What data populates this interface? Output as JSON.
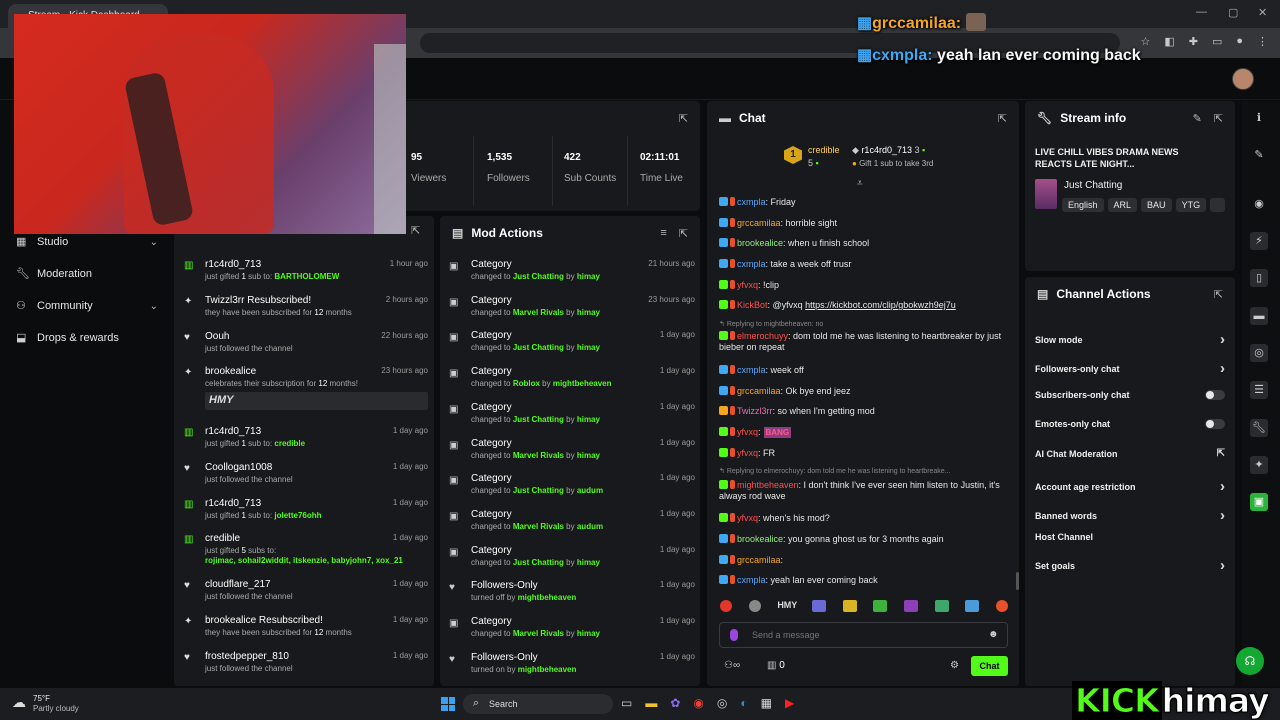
{
  "browser": {
    "tab_title": "Stream - Kick Dashboard"
  },
  "overlay": {
    "chat1_user": "grccamilaa:",
    "chat2_user": "cxmpla:",
    "chat2_text": "yeah lan ever coming back",
    "brand_kick": "KICK",
    "brand_name": "himay"
  },
  "sidebar": {
    "items": [
      {
        "label": "Studio",
        "icon": "studio-icon",
        "chevron": true
      },
      {
        "label": "Moderation",
        "icon": "wrench-icon",
        "chevron": false
      },
      {
        "label": "Community",
        "icon": "community-icon",
        "chevron": true
      },
      {
        "label": "Drops & rewards",
        "icon": "drops-icon",
        "chevron": false
      }
    ]
  },
  "stats": [
    {
      "value": "95",
      "label": "Viewers"
    },
    {
      "value": "1,535",
      "label": "Followers"
    },
    {
      "value": "422",
      "label": "Sub Counts"
    },
    {
      "value": "02:11:01",
      "label": "Time Live"
    }
  ],
  "activity": [
    {
      "icon": "gift-icon",
      "name": "r1c4rd0_713",
      "time": "1 hour ago",
      "pre": "just gifted ",
      "num": "1",
      "mid": " sub to: ",
      "target": "BARTHOLOMEW"
    },
    {
      "icon": "sparkle-icon",
      "name": "Twizzl3rr Resubscribed!",
      "time": "2 hours ago",
      "pre": "they have been subscribed for ",
      "num": "12",
      "mid": " months",
      "target": ""
    },
    {
      "icon": "heart-icon",
      "name": "Oouh",
      "time": "22 hours ago",
      "pre": "just followed the channel",
      "num": "",
      "mid": "",
      "target": ""
    },
    {
      "icon": "sparkle-icon",
      "name": "brookealice",
      "time": "23 hours ago",
      "pre": "celebrates their subscription for ",
      "num": "12",
      "mid": " months!",
      "target": "",
      "emote": "HMY"
    },
    {
      "icon": "gift-icon",
      "name": "r1c4rd0_713",
      "time": "1 day ago",
      "pre": "just gifted ",
      "num": "1",
      "mid": " sub to: ",
      "target": "credible"
    },
    {
      "icon": "heart-icon",
      "name": "Coollogan1008",
      "time": "1 day ago",
      "pre": "just followed the channel",
      "num": "",
      "mid": "",
      "target": ""
    },
    {
      "icon": "gift-icon",
      "name": "r1c4rd0_713",
      "time": "1 day ago",
      "pre": "just gifted ",
      "num": "1",
      "mid": " sub to: ",
      "target": "jolette76ohh"
    },
    {
      "icon": "gift-icon",
      "name": "credible",
      "time": "1 day ago",
      "pre": "just gifted ",
      "num": "5",
      "mid": " subs to:",
      "target": "rojimac, sohail2widdit, itskenzie, babyjohn7, xox_21"
    },
    {
      "icon": "heart-icon",
      "name": "cloudflare_217",
      "time": "1 day ago",
      "pre": "just followed the channel",
      "num": "",
      "mid": "",
      "target": ""
    },
    {
      "icon": "sparkle-icon",
      "name": "brookealice Resubscribed!",
      "time": "1 day ago",
      "pre": "they have been subscribed for ",
      "num": "12",
      "mid": " months",
      "target": ""
    },
    {
      "icon": "heart-icon",
      "name": "frostedpepper_810",
      "time": "1 day ago",
      "pre": "just followed the channel",
      "num": "",
      "mid": "",
      "target": ""
    }
  ],
  "mod_actions": {
    "title": "Mod Actions",
    "items": [
      {
        "icon": "category-icon",
        "name": "Category",
        "time": "21 hours ago",
        "pre": "changed to ",
        "what": "Just Chatting",
        "by": "himay"
      },
      {
        "icon": "category-icon",
        "name": "Category",
        "time": "23 hours ago",
        "pre": "changed to ",
        "what": "Marvel Rivals",
        "by": "himay"
      },
      {
        "icon": "category-icon",
        "name": "Category",
        "time": "1 day ago",
        "pre": "changed to ",
        "what": "Just Chatting",
        "by": "himay"
      },
      {
        "icon": "category-icon",
        "name": "Category",
        "time": "1 day ago",
        "pre": "changed to ",
        "what": "Roblox",
        "by": "mightbeheaven"
      },
      {
        "icon": "category-icon",
        "name": "Category",
        "time": "1 day ago",
        "pre": "changed to ",
        "what": "Just Chatting",
        "by": "himay"
      },
      {
        "icon": "category-icon",
        "name": "Category",
        "time": "1 day ago",
        "pre": "changed to ",
        "what": "Marvel Rivals",
        "by": "himay"
      },
      {
        "icon": "category-icon",
        "name": "Category",
        "time": "1 day ago",
        "pre": "changed to ",
        "what": "Just Chatting",
        "by": "audum"
      },
      {
        "icon": "category-icon",
        "name": "Category",
        "time": "1 day ago",
        "pre": "changed to ",
        "what": "Marvel Rivals",
        "by": "audum"
      },
      {
        "icon": "category-icon",
        "name": "Category",
        "time": "1 day ago",
        "pre": "changed to ",
        "what": "Just Chatting",
        "by": "himay"
      },
      {
        "icon": "heart-icon",
        "name": "Followers-Only",
        "time": "1 day ago",
        "pre": "turned off by ",
        "what": "",
        "by": "mightbeheaven"
      },
      {
        "icon": "category-icon",
        "name": "Category",
        "time": "1 day ago",
        "pre": "changed to ",
        "what": "Marvel Rivals",
        "by": "himay"
      },
      {
        "icon": "heart-icon",
        "name": "Followers-Only",
        "time": "1 day ago",
        "pre": "turned on by ",
        "what": "",
        "by": "mightbeheaven"
      }
    ]
  },
  "chat": {
    "title": "Chat",
    "top_gifter": "credible",
    "top_gifter_count": "5",
    "second_gifter": "r1c4rd0_713",
    "second_count": "3",
    "gift_prompt": "Gift 1 sub to take 3rd",
    "messages": [
      {
        "user": "cxmpla",
        "color": "u-blue",
        "text": ": Friday"
      },
      {
        "user": "grccamilaa",
        "color": "u-orange",
        "text": ": horrible sight"
      },
      {
        "user": "brookealice",
        "color": "u-green",
        "text": ": when u finish school"
      },
      {
        "user": "cxmpla",
        "color": "u-blue",
        "text": ": take a week off trusr"
      },
      {
        "user": "yfvxq",
        "color": "u-red",
        "text": ": !clip"
      },
      {
        "user": "KickBot",
        "color": "u-red",
        "text": ": @yfvxq ",
        "link": "https://kickbot.com/clip/gbokwzh9ej7u"
      },
      {
        "reply": "Replying to mightbeheaven: no"
      },
      {
        "user": "elmerochuyy",
        "color": "u-red",
        "text": ": dom told me he was listening to heartbreaker by just bieber on repeat"
      },
      {
        "user": "cxmpla",
        "color": "u-blue",
        "text": ": week off"
      },
      {
        "user": "grccamilaa",
        "color": "u-orange",
        "text": ": Ok bye end jeez"
      },
      {
        "user": "Twizzl3rr",
        "color": "u-pink",
        "text": ": so when I'm getting mod"
      },
      {
        "user": "yfvxq",
        "color": "u-red",
        "text": ":",
        "emote": "BANG"
      },
      {
        "user": "yfvxq",
        "color": "u-red",
        "text": ": FR"
      },
      {
        "reply": "Replying to elmerochuyy: dom told me he was listening to heartbreake..."
      },
      {
        "user": "mightbeheaven",
        "color": "u-red",
        "text": ": I don't think I've ever seen him listen to Justin, it's always rod wave"
      },
      {
        "user": "yfvxq",
        "color": "u-red",
        "text": ": when's his mod?"
      },
      {
        "user": "brookealice",
        "color": "u-green",
        "text": ": you gonna ghost us for 3 months again"
      },
      {
        "user": "grccamilaa",
        "color": "u-orange",
        "text": ":"
      },
      {
        "user": "cxmpla",
        "color": "u-blue",
        "text": ": yeah lan ever coming back"
      }
    ],
    "placeholder": "Send a message",
    "viewer_count": "0",
    "send_label": "Chat"
  },
  "stream_info": {
    "title": "Stream info",
    "stream_title": "LIVE CHILL VIBES DRAMA NEWS REACTS LATE NIGHT...",
    "category": "Just Chatting",
    "tags": [
      "English",
      "ARL",
      "BAU",
      "YTG"
    ]
  },
  "channel_actions": {
    "title": "Channel Actions",
    "items": [
      {
        "label": "Slow mode",
        "type": "chevron"
      },
      {
        "label": "Followers-only chat",
        "type": "chevron"
      },
      {
        "label": "Subscribers-only chat",
        "type": "toggle"
      },
      {
        "label": "Emotes-only chat",
        "type": "toggle"
      },
      {
        "label": "AI Chat Moderation",
        "type": "external"
      },
      {
        "label": "Account age restriction",
        "type": "chevron"
      },
      {
        "label": "Banned words",
        "type": "chevron"
      },
      {
        "label": "Host Channel",
        "type": "none"
      },
      {
        "label": "Set goals",
        "type": "chevron"
      }
    ]
  },
  "taskbar": {
    "weather_temp": "75°F",
    "weather_desc": "Partly cloudy",
    "search_label": "Search"
  },
  "colors": {
    "accent": "#53fc18",
    "panel": "#18191c",
    "background": "#0b0c0e"
  }
}
